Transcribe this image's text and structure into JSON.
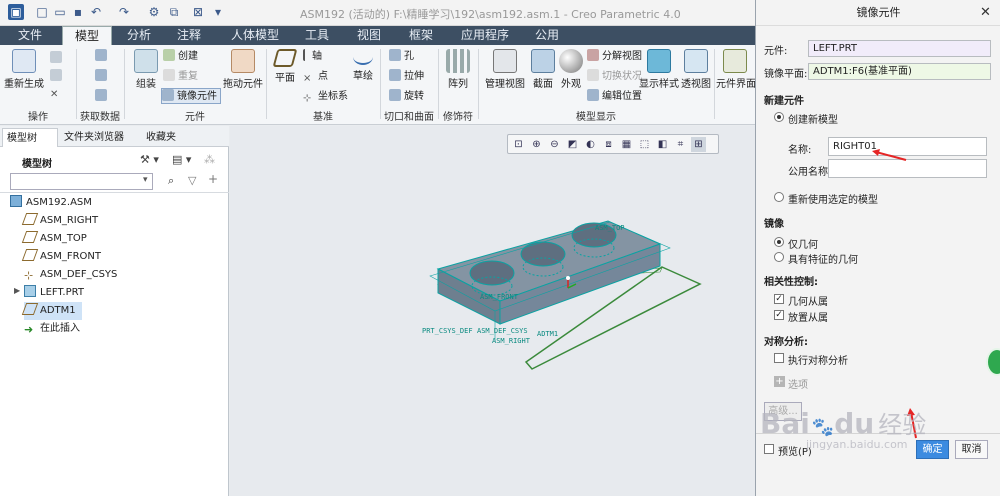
{
  "app": {
    "title": "ASM192 (活动的) F:\\精睡学习\\192\\asm192.asm.1 - Creo Parametric 4.0"
  },
  "quick_access": [
    "app-menu-icon",
    "new-icon",
    "open-icon",
    "save-icon",
    "undo-icon",
    "redo-icon",
    "regenerate-icon",
    "windows-icon",
    "close-window-icon",
    "customize-icon"
  ],
  "tabs": [
    "文件",
    "模型",
    "分析",
    "注释",
    "人体模型",
    "工具",
    "视图",
    "框架",
    "应用程序",
    "公用"
  ],
  "active_tab": "模型",
  "ribbon": {
    "groups": {
      "operations": "操作",
      "get_data": "获取数据",
      "component": "元件",
      "datum": "基准",
      "cut_surface": "切口和曲面",
      "modifier": "修饰符",
      "model_display": "模型显示"
    },
    "buttons": {
      "regenerate": "重新生成",
      "assemble": "组装",
      "create": "创建",
      "repeat": "重复",
      "mirror_component": "镜像元件",
      "drag_components": "拖动元件",
      "plane": "平面",
      "axis": "轴",
      "point": "点",
      "csys": "坐标系",
      "sketch": "草绘",
      "hole": "孔",
      "extrude": "拉伸",
      "revolve": "旋转",
      "pattern": "阵列",
      "manage_views": "管理视图",
      "section": "截面",
      "appearance": "外观",
      "explode_view": "分解视图",
      "toggle_status": "切换状况",
      "edit_position": "编辑位置",
      "display_style": "显示样式",
      "perspective": "透视图",
      "component_interface": "元件界面"
    }
  },
  "panel": {
    "tabs": [
      "模型树",
      "文件夹浏览器",
      "收藏夹"
    ],
    "tree_label": "模型树",
    "tree": [
      {
        "label": "ASM192.ASM",
        "icon": "assembly-icon"
      },
      {
        "label": "ASM_RIGHT",
        "icon": "datum-plane-icon"
      },
      {
        "label": "ASM_TOP",
        "icon": "datum-plane-icon"
      },
      {
        "label": "ASM_FRONT",
        "icon": "datum-plane-icon"
      },
      {
        "label": "ASM_DEF_CSYS",
        "icon": "csys-icon"
      },
      {
        "label": "LEFT.PRT",
        "icon": "part-icon"
      },
      {
        "label": "ADTM1",
        "icon": "datum-plane-icon"
      },
      {
        "label": "在此插入",
        "icon": "insert-arrow-icon"
      }
    ]
  },
  "model_labels": {
    "asm_top": "ASM_TOP",
    "asm_front": "ASM_FRONT",
    "prt_csys": "PRT_CSYS_DEF",
    "asm_def_csys": "ASM_DEF_CSYS",
    "adtm1": "ADTM1",
    "asm_right": "ASM_RIGHT"
  },
  "dialog": {
    "title": "镜像元件",
    "component_label": "元件:",
    "component_value": "LEFT.PRT",
    "mirror_plane_label": "镜像平面:",
    "mirror_plane_value": "ADTM1:F6(基准平面)",
    "new_component_section": "新建元件",
    "create_new_model": "创建新模型",
    "name_label": "名称:",
    "name_value": "RIGHT01",
    "common_name_label": "公用名称:",
    "common_name_value": "",
    "reuse_model": "重新使用选定的模型",
    "mirror_section": "镜像",
    "geometry_only": "仅几何",
    "geometry_with_features": "具有特征的几何",
    "dependency_section": "相关性控制:",
    "geometry_dependent": "几何从属",
    "placement_dependent": "放置从属",
    "symmetry_section": "对称分析:",
    "perform_symmetry": "执行对称分析",
    "options": "选项",
    "advanced": "高级...",
    "preview": "预览(P)",
    "ok": "确定",
    "cancel": "取消"
  },
  "watermark": {
    "brand": "Bai",
    "brand2": "du",
    "brand_cn": "经验",
    "url": "jingyan.baidu.com"
  },
  "colors": {
    "accent_tab_bar": "#3d4f63",
    "dialog_field_purple": "#f1ecfa",
    "dialog_field_green": "#eef8e6",
    "model_teal": "#00a0a0",
    "ok_button": "#3c8be0"
  }
}
